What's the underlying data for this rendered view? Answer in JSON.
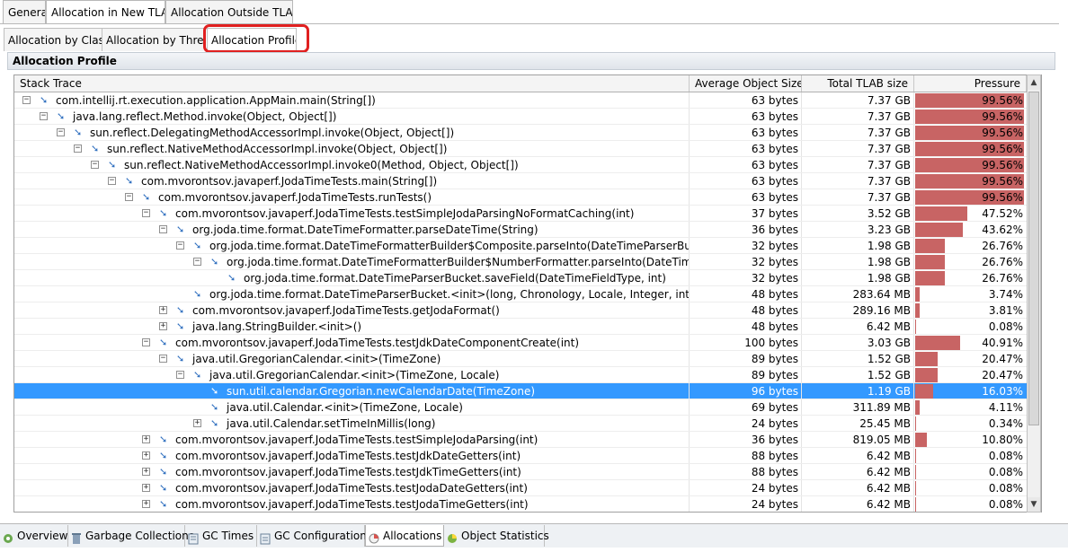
{
  "top_tabs": [
    {
      "label": "General",
      "active": false
    },
    {
      "label": "Allocation in New TLAB",
      "active": true
    },
    {
      "label": "Allocation Outside TLABs",
      "active": false
    }
  ],
  "sub_tabs": [
    {
      "label": "Allocation by Class",
      "active": false
    },
    {
      "label": "Allocation by Thread",
      "active": false
    },
    {
      "label": "Allocation Profile",
      "active": true
    }
  ],
  "section_title": "Allocation Profile",
  "columns": {
    "trace": "Stack Trace",
    "avg": "Average Object Size",
    "tlab": "Total TLAB size",
    "pressure": "Pressure"
  },
  "rows": [
    {
      "depth": 0,
      "toggle": "-",
      "label": "com.intellij.rt.execution.application.AppMain.main(String[])",
      "avg": "63 bytes",
      "tlab": "7.37 GB",
      "pressure": "99.56%",
      "p": 99.56
    },
    {
      "depth": 1,
      "toggle": "-",
      "label": "java.lang.reflect.Method.invoke(Object, Object[])",
      "avg": "63 bytes",
      "tlab": "7.37 GB",
      "pressure": "99.56%",
      "p": 99.56
    },
    {
      "depth": 2,
      "toggle": "-",
      "label": "sun.reflect.DelegatingMethodAccessorImpl.invoke(Object, Object[])",
      "avg": "63 bytes",
      "tlab": "7.37 GB",
      "pressure": "99.56%",
      "p": 99.56
    },
    {
      "depth": 3,
      "toggle": "-",
      "label": "sun.reflect.NativeMethodAccessorImpl.invoke(Object, Object[])",
      "avg": "63 bytes",
      "tlab": "7.37 GB",
      "pressure": "99.56%",
      "p": 99.56
    },
    {
      "depth": 4,
      "toggle": "-",
      "label": "sun.reflect.NativeMethodAccessorImpl.invoke0(Method, Object, Object[])",
      "avg": "63 bytes",
      "tlab": "7.37 GB",
      "pressure": "99.56%",
      "p": 99.56
    },
    {
      "depth": 5,
      "toggle": "-",
      "label": "com.mvorontsov.javaperf.JodaTimeTests.main(String[])",
      "avg": "63 bytes",
      "tlab": "7.37 GB",
      "pressure": "99.56%",
      "p": 99.56
    },
    {
      "depth": 6,
      "toggle": "-",
      "label": "com.mvorontsov.javaperf.JodaTimeTests.runTests()",
      "avg": "63 bytes",
      "tlab": "7.37 GB",
      "pressure": "99.56%",
      "p": 99.56
    },
    {
      "depth": 7,
      "toggle": "-",
      "label": "com.mvorontsov.javaperf.JodaTimeTests.testSimpleJodaParsingNoFormatCaching(int)",
      "avg": "37 bytes",
      "tlab": "3.52 GB",
      "pressure": "47.52%",
      "p": 47.52
    },
    {
      "depth": 8,
      "toggle": "-",
      "label": "org.joda.time.format.DateTimeFormatter.parseDateTime(String)",
      "avg": "36 bytes",
      "tlab": "3.23 GB",
      "pressure": "43.62%",
      "p": 43.62
    },
    {
      "depth": 9,
      "toggle": "-",
      "label": "org.joda.time.format.DateTimeFormatterBuilder$Composite.parseInto(DateTimeParserBucket, String, int)",
      "avg": "32 bytes",
      "tlab": "1.98 GB",
      "pressure": "26.76%",
      "p": 26.76
    },
    {
      "depth": 10,
      "toggle": "-",
      "label": "org.joda.time.format.DateTimeFormatterBuilder$NumberFormatter.parseInto(DateTimeParserBucket, String, int)",
      "avg": "32 bytes",
      "tlab": "1.98 GB",
      "pressure": "26.76%",
      "p": 26.76
    },
    {
      "depth": 11,
      "toggle": "",
      "label": "org.joda.time.format.DateTimeParserBucket.saveField(DateTimeFieldType, int)",
      "avg": "32 bytes",
      "tlab": "1.98 GB",
      "pressure": "26.76%",
      "p": 26.76
    },
    {
      "depth": 9,
      "toggle": "",
      "label": "org.joda.time.format.DateTimeParserBucket.<init>(long, Chronology, Locale, Integer, int)",
      "avg": "48 bytes",
      "tlab": "283.64 MB",
      "pressure": "3.74%",
      "p": 3.74
    },
    {
      "depth": 8,
      "toggle": "+",
      "label": "com.mvorontsov.javaperf.JodaTimeTests.getJodaFormat()",
      "avg": "48 bytes",
      "tlab": "289.16 MB",
      "pressure": "3.81%",
      "p": 3.81
    },
    {
      "depth": 8,
      "toggle": "+",
      "label": "java.lang.StringBuilder.<init>()",
      "avg": "48 bytes",
      "tlab": "6.42 MB",
      "pressure": "0.08%",
      "p": 0.08
    },
    {
      "depth": 7,
      "toggle": "-",
      "label": "com.mvorontsov.javaperf.JodaTimeTests.testJdkDateComponentCreate(int)",
      "avg": "100 bytes",
      "tlab": "3.03 GB",
      "pressure": "40.91%",
      "p": 40.91
    },
    {
      "depth": 8,
      "toggle": "-",
      "label": "java.util.GregorianCalendar.<init>(TimeZone)",
      "avg": "89 bytes",
      "tlab": "1.52 GB",
      "pressure": "20.47%",
      "p": 20.47
    },
    {
      "depth": 9,
      "toggle": "-",
      "label": "java.util.GregorianCalendar.<init>(TimeZone, Locale)",
      "avg": "89 bytes",
      "tlab": "1.52 GB",
      "pressure": "20.47%",
      "p": 20.47
    },
    {
      "depth": 10,
      "toggle": "",
      "label": "sun.util.calendar.Gregorian.newCalendarDate(TimeZone)",
      "avg": "96 bytes",
      "tlab": "1.19 GB",
      "pressure": "16.03%",
      "p": 16.03,
      "selected": true
    },
    {
      "depth": 10,
      "toggle": "",
      "label": "java.util.Calendar.<init>(TimeZone, Locale)",
      "avg": "69 bytes",
      "tlab": "311.89 MB",
      "pressure": "4.11%",
      "p": 4.11
    },
    {
      "depth": 10,
      "toggle": "+",
      "label": "java.util.Calendar.setTimeInMillis(long)",
      "avg": "24 bytes",
      "tlab": "25.45 MB",
      "pressure": "0.34%",
      "p": 0.34
    },
    {
      "depth": 7,
      "toggle": "+",
      "label": "com.mvorontsov.javaperf.JodaTimeTests.testSimpleJodaParsing(int)",
      "avg": "36 bytes",
      "tlab": "819.05 MB",
      "pressure": "10.80%",
      "p": 10.8
    },
    {
      "depth": 7,
      "toggle": "+",
      "label": "com.mvorontsov.javaperf.JodaTimeTests.testJdkDateGetters(int)",
      "avg": "88 bytes",
      "tlab": "6.42 MB",
      "pressure": "0.08%",
      "p": 0.08
    },
    {
      "depth": 7,
      "toggle": "+",
      "label": "com.mvorontsov.javaperf.JodaTimeTests.testJdkTimeGetters(int)",
      "avg": "88 bytes",
      "tlab": "6.42 MB",
      "pressure": "0.08%",
      "p": 0.08
    },
    {
      "depth": 7,
      "toggle": "+",
      "label": "com.mvorontsov.javaperf.JodaTimeTests.testJodaDateGetters(int)",
      "avg": "24 bytes",
      "tlab": "6.42 MB",
      "pressure": "0.08%",
      "p": 0.08
    },
    {
      "depth": 7,
      "toggle": "+",
      "label": "com.mvorontsov.javaperf.JodaTimeTests.testJodaTimeGetters(int)",
      "avg": "24 bytes",
      "tlab": "6.42 MB",
      "pressure": "0.08%",
      "p": 0.08
    }
  ],
  "bottom_tabs": [
    {
      "label": "Overview",
      "icon": "overview-icon",
      "active": false
    },
    {
      "label": "Garbage Collections",
      "icon": "trash-icon",
      "active": false
    },
    {
      "label": "GC Times",
      "icon": "gc-times-icon",
      "active": false
    },
    {
      "label": "GC Configuration",
      "icon": "gc-config-icon",
      "active": false
    },
    {
      "label": "Allocations",
      "icon": "allocations-icon",
      "active": true
    },
    {
      "label": "Object Statistics",
      "icon": "object-statistics-icon",
      "active": false
    }
  ],
  "colors": {
    "pressure_bar": "#c86464",
    "selection": "#3399ff",
    "highlight_ring": "#e02020"
  }
}
